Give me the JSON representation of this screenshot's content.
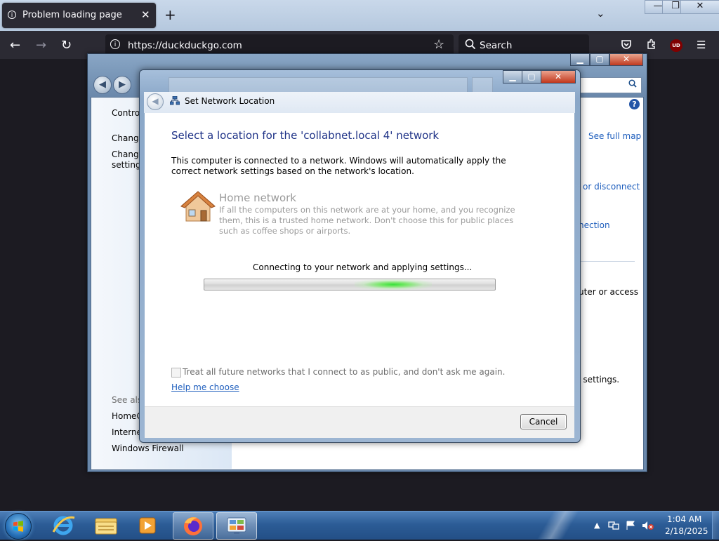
{
  "browser": {
    "tab_title": "Problem loading page",
    "tab_close": "✕",
    "new_tab": "+",
    "tab_list": "⌄",
    "url": "https://duckduckgo.com",
    "search_placeholder": "Search",
    "ublock_label": "UD",
    "window_min": "—",
    "window_max": "❐",
    "window_close": "✕"
  },
  "control_panel": {
    "sidebar": {
      "home": "Control",
      "link1": "Change",
      "link2a": "Change",
      "link2b": "settings",
      "see_also": "See also",
      "see_also_items": [
        "HomeG",
        "Internet",
        "Windows Firewall"
      ]
    },
    "main": {
      "see_full_map": "See full map",
      "connect_or_disconnect": "or disconnect",
      "connection": "nection",
      "router_or_access": "uter or access",
      "settings": "g settings."
    },
    "help_label": "?"
  },
  "dialog": {
    "title": "Set Network Location",
    "heading": "Select a location for the 'collabnet.local  4' network",
    "description": "This computer is connected to a network. Windows will automatically apply the correct network settings based on the network's location.",
    "home_title": "Home network",
    "home_description": "If all the computers on this network are at your home, and you recognize them, this is a trusted home network.  Don't choose this for public places such as coffee shops or airports.",
    "status": "Connecting to your network and applying settings...",
    "progress_glow_position": 0.65,
    "checkbox_label": "Treat all future networks that I connect to as public, and don't ask me again.",
    "checkbox_checked": false,
    "help_link": "Help me choose",
    "cancel": "Cancel"
  },
  "taskbar": {
    "time": "1:04 AM",
    "date": "2/18/2025",
    "apps": [
      "internet-explorer",
      "windows-explorer",
      "media-player",
      "firefox",
      "control-panel"
    ]
  },
  "colors": {
    "heading_blue": "#1e3287",
    "link_blue": "#1e5ebd",
    "progress_green": "#38e03b",
    "taskbar_blue": "#2c5c96"
  }
}
